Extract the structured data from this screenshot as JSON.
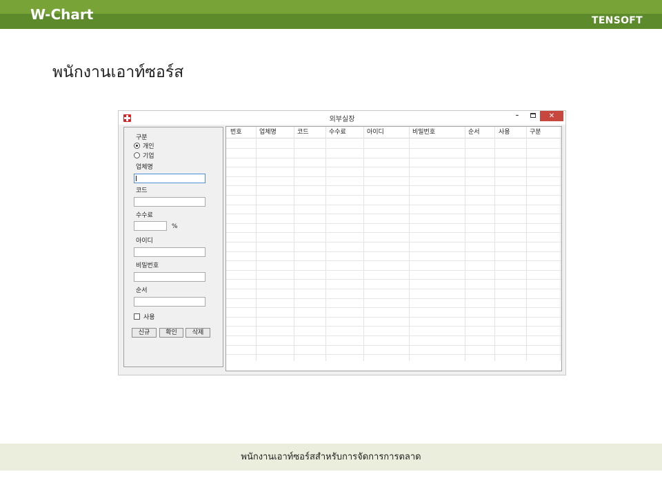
{
  "header": {
    "brand": "W-Chart",
    "company": "TENSOFT",
    "accent_color": "#78a437",
    "accent_dark": "#5d8a2b"
  },
  "heading": "พนักงานเอาท์ซอร์ส",
  "window": {
    "title": "외부실장",
    "icon": "red-cross-icon",
    "controls": {
      "minimize": "–",
      "close": "✕"
    },
    "form": {
      "type_label": "구분",
      "type_options": [
        {
          "label": "개인",
          "selected": true
        },
        {
          "label": "기업",
          "selected": false
        }
      ],
      "company_label": "업체명",
      "company_value": "",
      "code_label": "코드",
      "code_value": "",
      "fee_label": "수수료",
      "fee_value": "",
      "fee_unit": "%",
      "id_label": "아이디",
      "id_value": "",
      "password_label": "비밀번호",
      "password_value": "",
      "order_label": "순서",
      "order_value": "",
      "use_label": "사용",
      "use_checked": false,
      "buttons": {
        "new": "신규",
        "confirm": "확인",
        "delete": "삭제"
      }
    },
    "table": {
      "columns": [
        "번호",
        "업체명",
        "코드",
        "수수료",
        "아이디",
        "비밀번호",
        "순서",
        "사용",
        "구분"
      ],
      "rows": []
    }
  },
  "footer": {
    "text": "พนักงานเอาท์ซอร์สสำหรับการจัดการการตลาด",
    "background": "#ebeedd"
  }
}
